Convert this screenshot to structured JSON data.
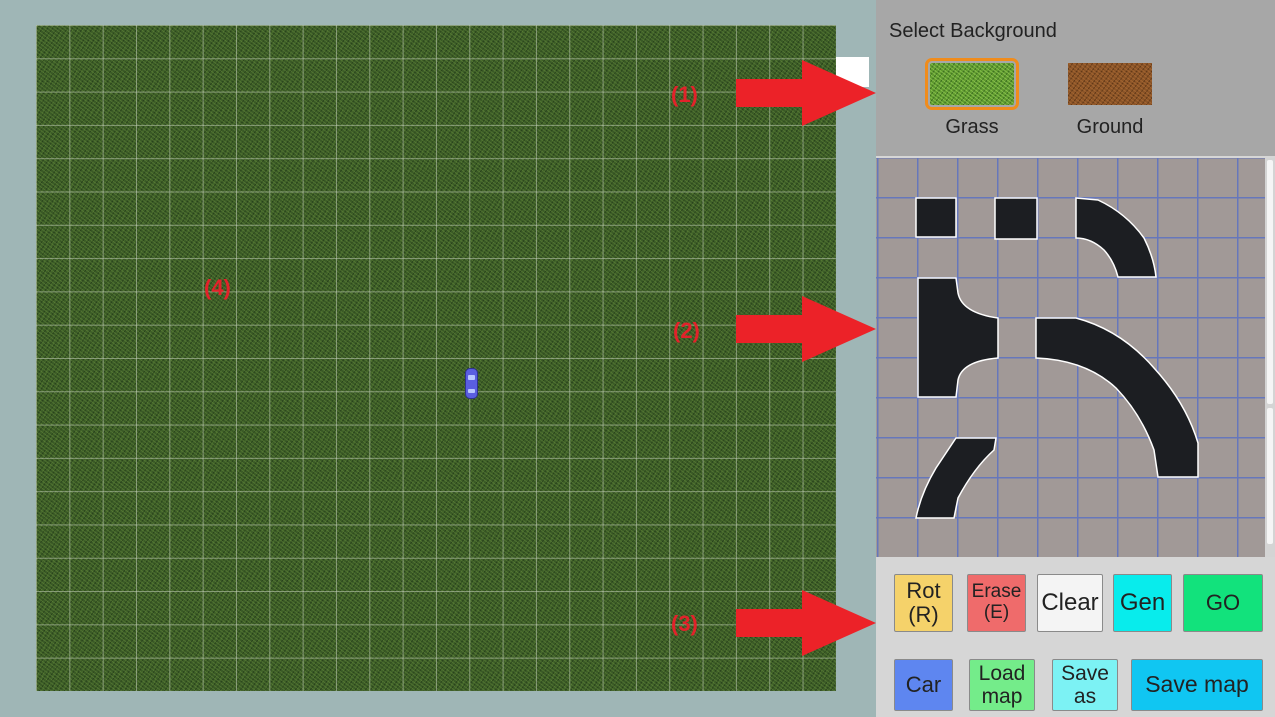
{
  "annotations": {
    "label1": "(1)",
    "label2": "(2)",
    "label3": "(3)",
    "label4": "(4)"
  },
  "background_selector": {
    "title": "Select Background",
    "options": [
      {
        "label": "Grass",
        "selected": true
      },
      {
        "label": "Ground",
        "selected": false
      }
    ]
  },
  "tile_palette": {
    "tiles": [
      "square-block",
      "square-block-2",
      "curve-small",
      "t-junction",
      "curve-large",
      "diagonal-ramp"
    ]
  },
  "buttons": {
    "rot": {
      "line1": "Rot",
      "line2": "(R)"
    },
    "erase": {
      "line1": "Erase",
      "line2": "(E)"
    },
    "clear": "Clear",
    "gen": "Gen",
    "go": "GO",
    "car": "Car",
    "load": {
      "line1": "Load",
      "line2": "map"
    },
    "save_as": {
      "line1": "Save",
      "line2": "as"
    },
    "save_map": "Save map"
  },
  "colors": {
    "rot": "#f5d26a",
    "erase": "#ef6b6b",
    "clear": "#f4f4f4",
    "gen": "#08ecec",
    "go": "#12e27c",
    "car": "#5e86f0",
    "load": "#74ec8a",
    "save_as": "#7cf2f4",
    "save_map": "#10c6f2",
    "arrow": "#ec2228",
    "selected_outline": "#f08c1c"
  }
}
